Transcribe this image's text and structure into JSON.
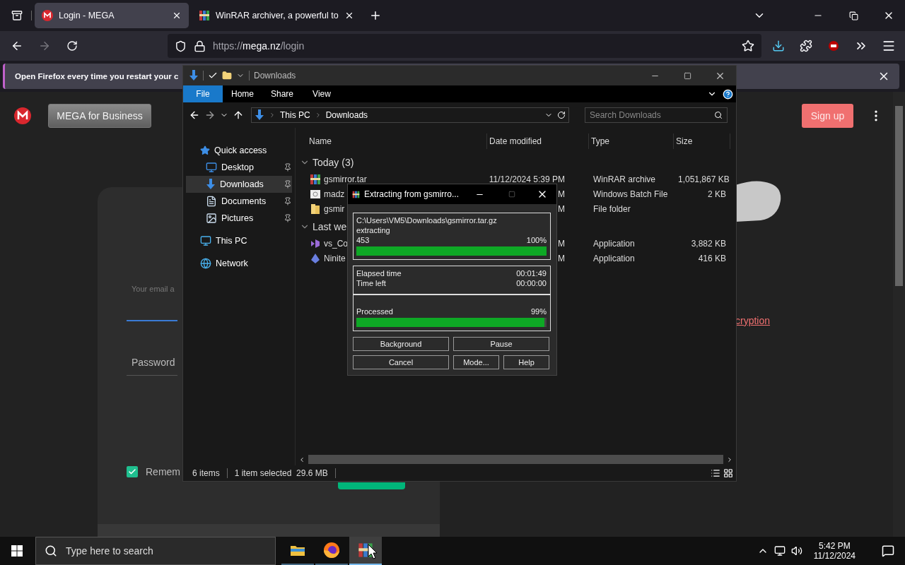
{
  "browser": {
    "tabs": [
      {
        "title": "Login - MEGA",
        "selected": true
      },
      {
        "title": "WinRAR archiver, a powerful to",
        "selected": false
      }
    ],
    "url": {
      "scheme": "https://",
      "host": "mega.nz",
      "path": "/login"
    },
    "notification": {
      "message": "Open Firefox every time you restart your c"
    },
    "page": {
      "business_button": "MEGA for Business",
      "signup_button": "Sign up",
      "email": {
        "placeholder": "Your email a"
      },
      "password": {
        "label": "Password"
      },
      "remember": {
        "label": "Remem",
        "checked": true
      },
      "link": "cryption"
    }
  },
  "explorer": {
    "title": "Downloads",
    "ribbon_tabs": [
      {
        "label": "File",
        "selected": true
      },
      {
        "label": "Home",
        "selected": false
      },
      {
        "label": "Share",
        "selected": false
      },
      {
        "label": "View",
        "selected": false
      }
    ],
    "breadcrumb": [
      "This PC",
      "Downloads"
    ],
    "search": {
      "placeholder": "Search Downloads"
    },
    "nav": [
      {
        "label": "Quick access",
        "kind": "star",
        "selected": false,
        "children": [
          {
            "label": "Desktop",
            "kind": "desktop",
            "pinned": true,
            "selected": false
          },
          {
            "label": "Downloads",
            "kind": "download",
            "pinned": true,
            "selected": true
          },
          {
            "label": "Documents",
            "kind": "document",
            "pinned": true,
            "selected": false
          },
          {
            "label": "Pictures",
            "kind": "pictures",
            "pinned": true,
            "selected": false
          }
        ]
      },
      {
        "label": "This PC",
        "kind": "pc",
        "selected": false
      },
      {
        "label": "Network",
        "kind": "network",
        "selected": false
      }
    ],
    "columns": [
      "Name",
      "Date modified",
      "Type",
      "Size"
    ],
    "groups": [
      {
        "label": "Today (3)",
        "rows": [
          {
            "name": "gsmirror.tar",
            "kind": "archive",
            "date": "11/12/2024 5:39 PM",
            "type": "WinRAR archive",
            "size": "1,051,867 KB"
          },
          {
            "name": "madz",
            "kind": "batch",
            "date": "M",
            "type": "Windows Batch File",
            "size": "2 KB"
          },
          {
            "name": "gsmir",
            "kind": "folder",
            "date": "M",
            "type": "File folder"
          }
        ]
      },
      {
        "label": "Last we",
        "rows": [
          {
            "name": "vs_Co",
            "kind": "vs",
            "date": "M",
            "type": "Application",
            "size": "3,882 KB"
          },
          {
            "name": "Ninite",
            "kind": "ninite",
            "date": "M",
            "type": "Application",
            "size": "416 KB"
          }
        ]
      }
    ],
    "status": {
      "items": "6 items",
      "selection": "1 item selected  29.6 MB"
    }
  },
  "dialog": {
    "title": "Extracting from gsmirro...",
    "path": "C:\\Users\\VM5\\Downloads\\gsmirror.tar.gz",
    "action": "extracting",
    "count": "453",
    "file_progress": {
      "percent": "100%",
      "level": 1
    },
    "times": [
      {
        "label": "Elapsed time",
        "value": "00:01:49"
      },
      {
        "label": "Time left",
        "value": "00:00:00"
      }
    ],
    "processed": {
      "label": "Processed",
      "percent": "99%",
      "level": 0.99
    },
    "buttons": [
      "Background",
      "Pause",
      "Cancel",
      "Mode...",
      "Help"
    ]
  },
  "taskbar": {
    "search": {
      "placeholder": "Type here to search"
    },
    "apps": [
      {
        "kind": "explorer",
        "selected": false
      },
      {
        "kind": "firefox",
        "selected": false
      },
      {
        "kind": "winrar",
        "selected": true
      }
    ],
    "time": "5:42 PM",
    "date": "11/12/2024"
  }
}
